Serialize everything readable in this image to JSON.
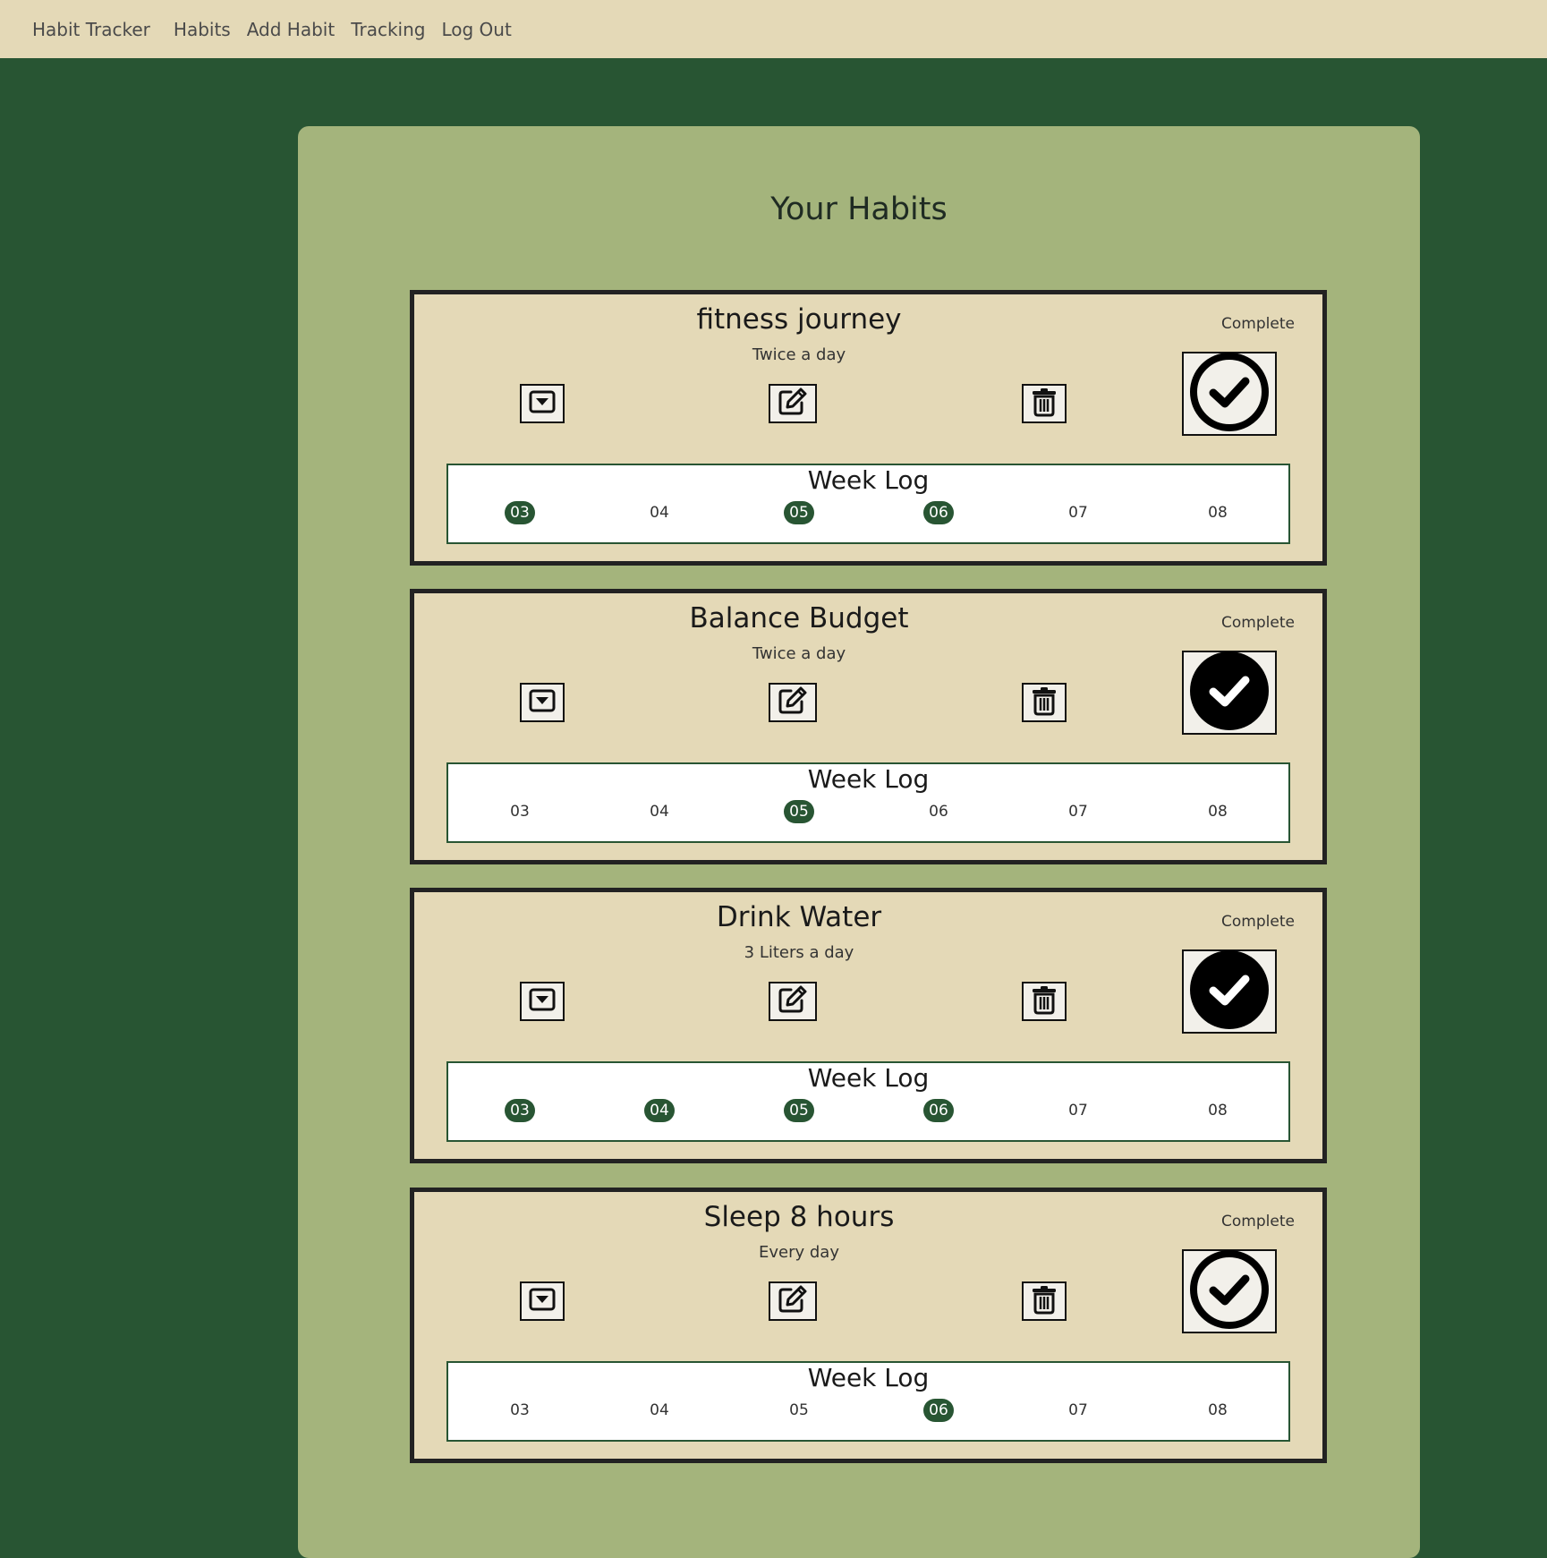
{
  "nav": {
    "brand": "Habit Tracker",
    "links": [
      "Habits",
      "Add Habit",
      "Tracking",
      "Log Out"
    ]
  },
  "page_title": "Your Habits",
  "colors": {
    "background": "#285533",
    "navbar": "#e4d9b7",
    "panel": "#a4b47c",
    "card": "#e4d9b7",
    "done_day": "#285533"
  },
  "icons": {
    "expand": "caret-square-down-icon",
    "edit": "edit-icon",
    "delete": "trash-icon",
    "complete": "check-circle-icon"
  },
  "habits": [
    {
      "name": "fitness journey",
      "frequency": "Twice a day",
      "complete_label": "Complete",
      "completed_today": false,
      "week_log_title": "Week Log",
      "days": [
        {
          "label": "03",
          "done": true
        },
        {
          "label": "04",
          "done": false
        },
        {
          "label": "05",
          "done": true
        },
        {
          "label": "06",
          "done": true
        },
        {
          "label": "07",
          "done": false
        },
        {
          "label": "08",
          "done": false
        }
      ]
    },
    {
      "name": "Balance Budget",
      "frequency": "Twice a day",
      "complete_label": "Complete",
      "completed_today": true,
      "week_log_title": "Week Log",
      "days": [
        {
          "label": "03",
          "done": false
        },
        {
          "label": "04",
          "done": false
        },
        {
          "label": "05",
          "done": true
        },
        {
          "label": "06",
          "done": false
        },
        {
          "label": "07",
          "done": false
        },
        {
          "label": "08",
          "done": false
        }
      ]
    },
    {
      "name": "Drink Water",
      "frequency": "3 Liters a day",
      "complete_label": "Complete",
      "completed_today": true,
      "week_log_title": "Week Log",
      "days": [
        {
          "label": "03",
          "done": true
        },
        {
          "label": "04",
          "done": true
        },
        {
          "label": "05",
          "done": true
        },
        {
          "label": "06",
          "done": true
        },
        {
          "label": "07",
          "done": false
        },
        {
          "label": "08",
          "done": false
        }
      ]
    },
    {
      "name": "Sleep 8 hours",
      "frequency": "Every day",
      "complete_label": "Complete",
      "completed_today": false,
      "week_log_title": "Week Log",
      "days": [
        {
          "label": "03",
          "done": false
        },
        {
          "label": "04",
          "done": false
        },
        {
          "label": "05",
          "done": false
        },
        {
          "label": "06",
          "done": true
        },
        {
          "label": "07",
          "done": false
        },
        {
          "label": "08",
          "done": false
        }
      ]
    }
  ]
}
